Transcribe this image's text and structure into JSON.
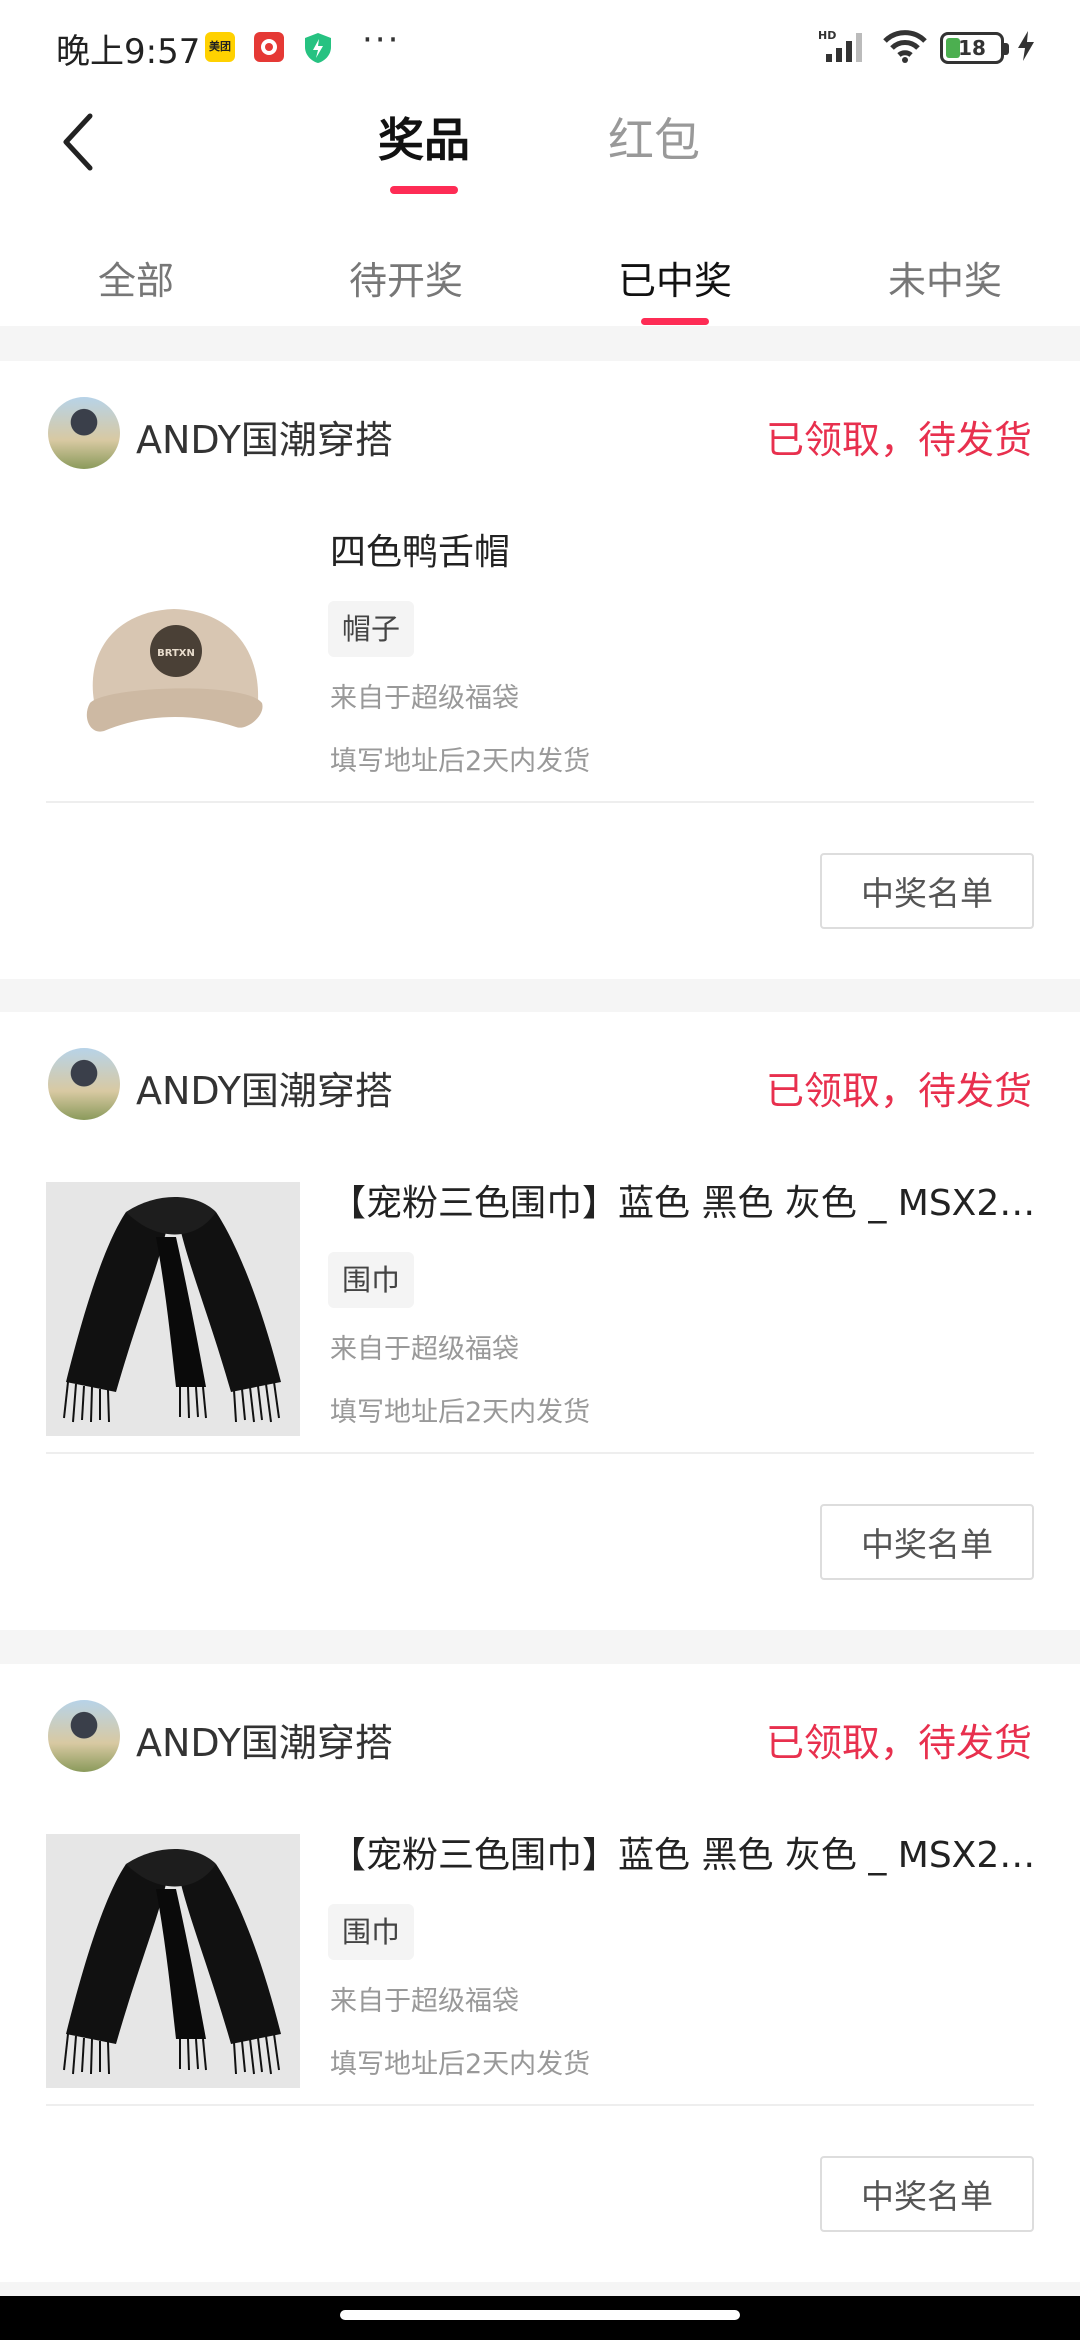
{
  "status_bar": {
    "time": "晚上9:57",
    "apps": [
      "美团",
      "拼多多",
      "安全"
    ],
    "more": "···",
    "network": "HD",
    "battery": "18"
  },
  "top_tabs": {
    "prizes": "奖品",
    "red_packet": "红包"
  },
  "sub_tabs": [
    "全部",
    "待开奖",
    "已中奖",
    "未中奖"
  ],
  "cards": [
    {
      "shop": "ANDY国潮穿搭",
      "status": "已领取，待发货",
      "title": "四色鸭舌帽",
      "tag": "帽子",
      "source": "来自于超级福袋",
      "ship": "填写地址后2天内发货",
      "button": "中奖名单",
      "thumb_text": "BRTXN"
    },
    {
      "shop": "ANDY国潮穿搭",
      "status": "已领取，待发货",
      "title": "【宠粉三色围巾】蓝色 黑色 灰色 _ MSX20...",
      "tag": "围巾",
      "source": "来自于超级福袋",
      "ship": "填写地址后2天内发货",
      "button": "中奖名单"
    },
    {
      "shop": "ANDY国潮穿搭",
      "status": "已领取，待发货",
      "title": "【宠粉三色围巾】蓝色 黑色 灰色 _ MSX20...",
      "tag": "围巾",
      "source": "来自于超级福袋",
      "ship": "填写地址后2天内发货",
      "button": "中奖名单"
    }
  ],
  "colors": {
    "accent": "#fe2c55",
    "status_red": "#e8304e"
  },
  "icons": [
    "back-arrow-icon",
    "signal-icon",
    "wifi-icon",
    "battery-icon",
    "charging-icon"
  ]
}
